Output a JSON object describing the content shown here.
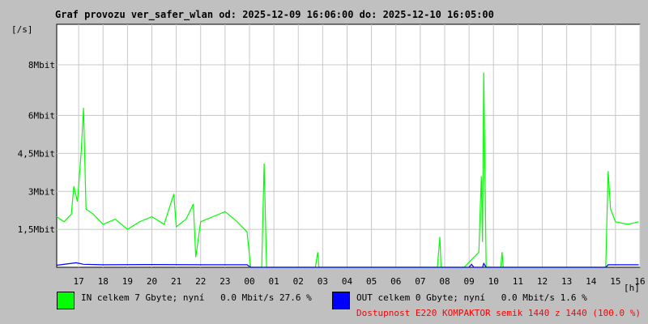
{
  "chart_data": {
    "type": "line",
    "title": "Graf provozu ver_safer_wlan od: 2025-12-09 16:06:00 do: 2025-12-10 16:05:00",
    "ylabel": "[/s]",
    "xlabel": "[h]",
    "ylim_mbit": [
      0,
      9.6
    ],
    "y_ticks": [
      {
        "value": 1.5,
        "label": "1,5Mbit"
      },
      {
        "value": 3,
        "label": "3Mbit"
      },
      {
        "value": 4.5,
        "label": "4,5Mbit"
      },
      {
        "value": 6,
        "label": "6Mbit"
      },
      {
        "value": 8,
        "label": "8Mbit"
      }
    ],
    "x_ticks": [
      "17",
      "18",
      "19",
      "20",
      "21",
      "22",
      "23",
      "00",
      "01",
      "02",
      "03",
      "04",
      "05",
      "06",
      "07",
      "08",
      "09",
      "10",
      "11",
      "12",
      "13",
      "14",
      "15",
      "16"
    ],
    "grid": true,
    "series": [
      {
        "name": "IN",
        "color": "#00ff00",
        "points": [
          [
            16.1,
            2.0
          ],
          [
            16.4,
            1.8
          ],
          [
            16.7,
            2.1
          ],
          [
            16.8,
            3.2
          ],
          [
            16.95,
            2.6
          ],
          [
            17.1,
            4.5
          ],
          [
            17.2,
            6.3
          ],
          [
            17.3,
            2.3
          ],
          [
            17.6,
            2.1
          ],
          [
            18.0,
            1.7
          ],
          [
            18.5,
            1.9
          ],
          [
            19.0,
            1.5
          ],
          [
            19.5,
            1.8
          ],
          [
            20.0,
            2.0
          ],
          [
            20.5,
            1.7
          ],
          [
            20.9,
            2.9
          ],
          [
            21.0,
            1.6
          ],
          [
            21.4,
            1.9
          ],
          [
            21.7,
            2.5
          ],
          [
            21.8,
            0.4
          ],
          [
            22.0,
            1.8
          ],
          [
            22.5,
            2.0
          ],
          [
            23.0,
            2.2
          ],
          [
            23.5,
            1.8
          ],
          [
            23.9,
            1.4
          ],
          [
            24.05,
            0.0
          ],
          [
            24.5,
            0.0
          ],
          [
            24.6,
            4.1
          ],
          [
            24.7,
            0.0
          ],
          [
            26.7,
            0.0
          ],
          [
            26.8,
            0.6
          ],
          [
            26.85,
            0.0
          ],
          [
            31.7,
            0.0
          ],
          [
            31.8,
            1.2
          ],
          [
            31.85,
            0.0
          ],
          [
            32.8,
            0.0
          ],
          [
            33.2,
            0.4
          ],
          [
            33.4,
            0.6
          ],
          [
            33.5,
            3.6
          ],
          [
            33.55,
            1.0
          ],
          [
            33.6,
            7.7
          ],
          [
            33.7,
            0.0
          ],
          [
            34.3,
            0.0
          ],
          [
            34.35,
            0.6
          ],
          [
            34.4,
            0.0
          ],
          [
            38.6,
            0.0
          ],
          [
            38.7,
            3.8
          ],
          [
            38.8,
            2.3
          ],
          [
            39.0,
            1.8
          ],
          [
            39.5,
            1.7
          ],
          [
            39.95,
            1.8
          ]
        ]
      },
      {
        "name": "OUT",
        "color": "#0000ff",
        "points": [
          [
            16.1,
            0.08
          ],
          [
            16.9,
            0.18
          ],
          [
            17.2,
            0.12
          ],
          [
            18.0,
            0.1
          ],
          [
            20.0,
            0.11
          ],
          [
            22.0,
            0.1
          ],
          [
            23.9,
            0.1
          ],
          [
            24.05,
            0.0
          ],
          [
            33.0,
            0.0
          ],
          [
            33.1,
            0.12
          ],
          [
            33.2,
            0.0
          ],
          [
            33.55,
            0.0
          ],
          [
            33.6,
            0.15
          ],
          [
            33.7,
            0.0
          ],
          [
            38.6,
            0.0
          ],
          [
            38.7,
            0.1
          ],
          [
            39.95,
            0.1
          ]
        ]
      }
    ],
    "legend": [
      {
        "color": "#00ff00",
        "text": "IN celkem 7 Gbyte; nyní   0.0 Mbit/s 27.6 %"
      },
      {
        "color": "#0000ff",
        "text": "OUT celkem 0 Gbyte; nyní   0.0 Mbit/s 1.6 %"
      }
    ],
    "availability": {
      "text": "Dostupnost E220 KOMPAKTOR semik 1440 z 1440 (100.0 %)",
      "color": "#ff0000"
    }
  }
}
